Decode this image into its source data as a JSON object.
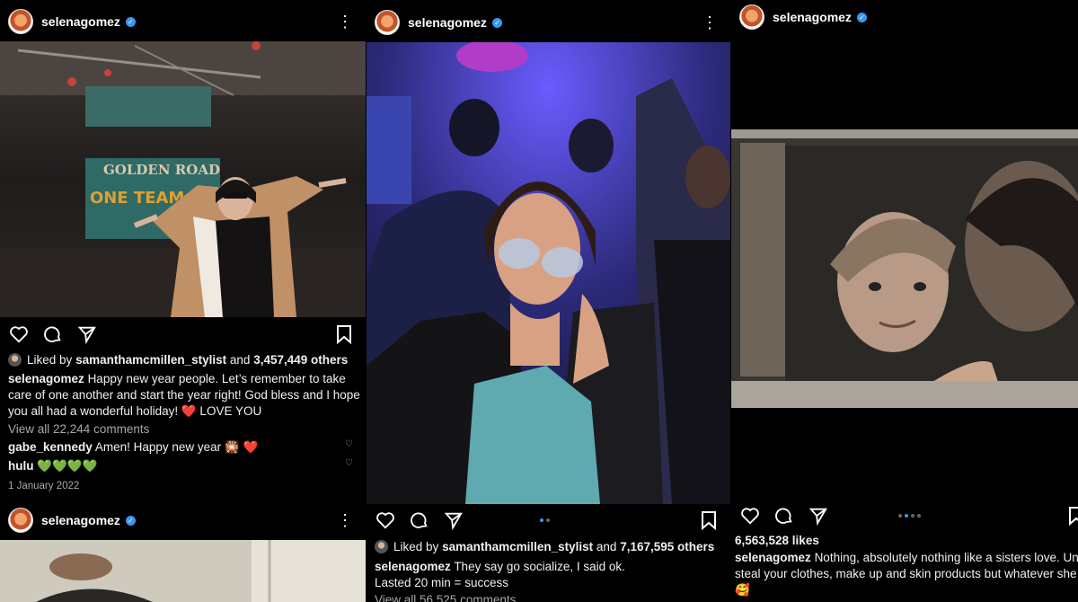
{
  "posts": [
    {
      "username": "selenagomez",
      "liked_by_prefix": "Liked by",
      "liked_by_user": "samanthamcmillen_stylist",
      "liked_by_and": "and",
      "likes_others": "3,457,449 others",
      "caption_user": "selenagomez",
      "caption": "Happy new year people. Let’s remember to take care of one another and start the year right! God bless and I hope you all had a wonderful holiday! ❤️ LOVE YOU",
      "view_comments": "View all 22,244 comments",
      "comments": [
        {
          "user": "gabe_kennedy",
          "text": "Amen! Happy new year 🎇 ❤️"
        },
        {
          "user": "hulu",
          "text": "💚💚💚💚"
        }
      ],
      "date": "1 January 2022",
      "photo_banner": "GOLDEN ROAD",
      "photo_banner_2": "ONE TEAM, ONE"
    },
    {
      "username": "selenagomez",
      "liked_by_prefix": "Liked by",
      "liked_by_user": "samanthamcmillen_stylist",
      "liked_by_and": "and",
      "likes_others": "7,167,595 others",
      "caption_user": "selenagomez",
      "caption_line1": "They say go socialize, I said ok.",
      "caption_line2": "Lasted 20 min = success",
      "view_comments": "View all 56,525 comments"
    },
    {
      "username": "selenagomez",
      "likes": "6,563,528 likes",
      "caption_user": "selenagomez",
      "caption": "Nothing, absolutely nothing like a sisters love. Until they steal your clothes, make up and skin products but whatever she cute 🥰"
    },
    {
      "username": "selenagomez"
    }
  ]
}
